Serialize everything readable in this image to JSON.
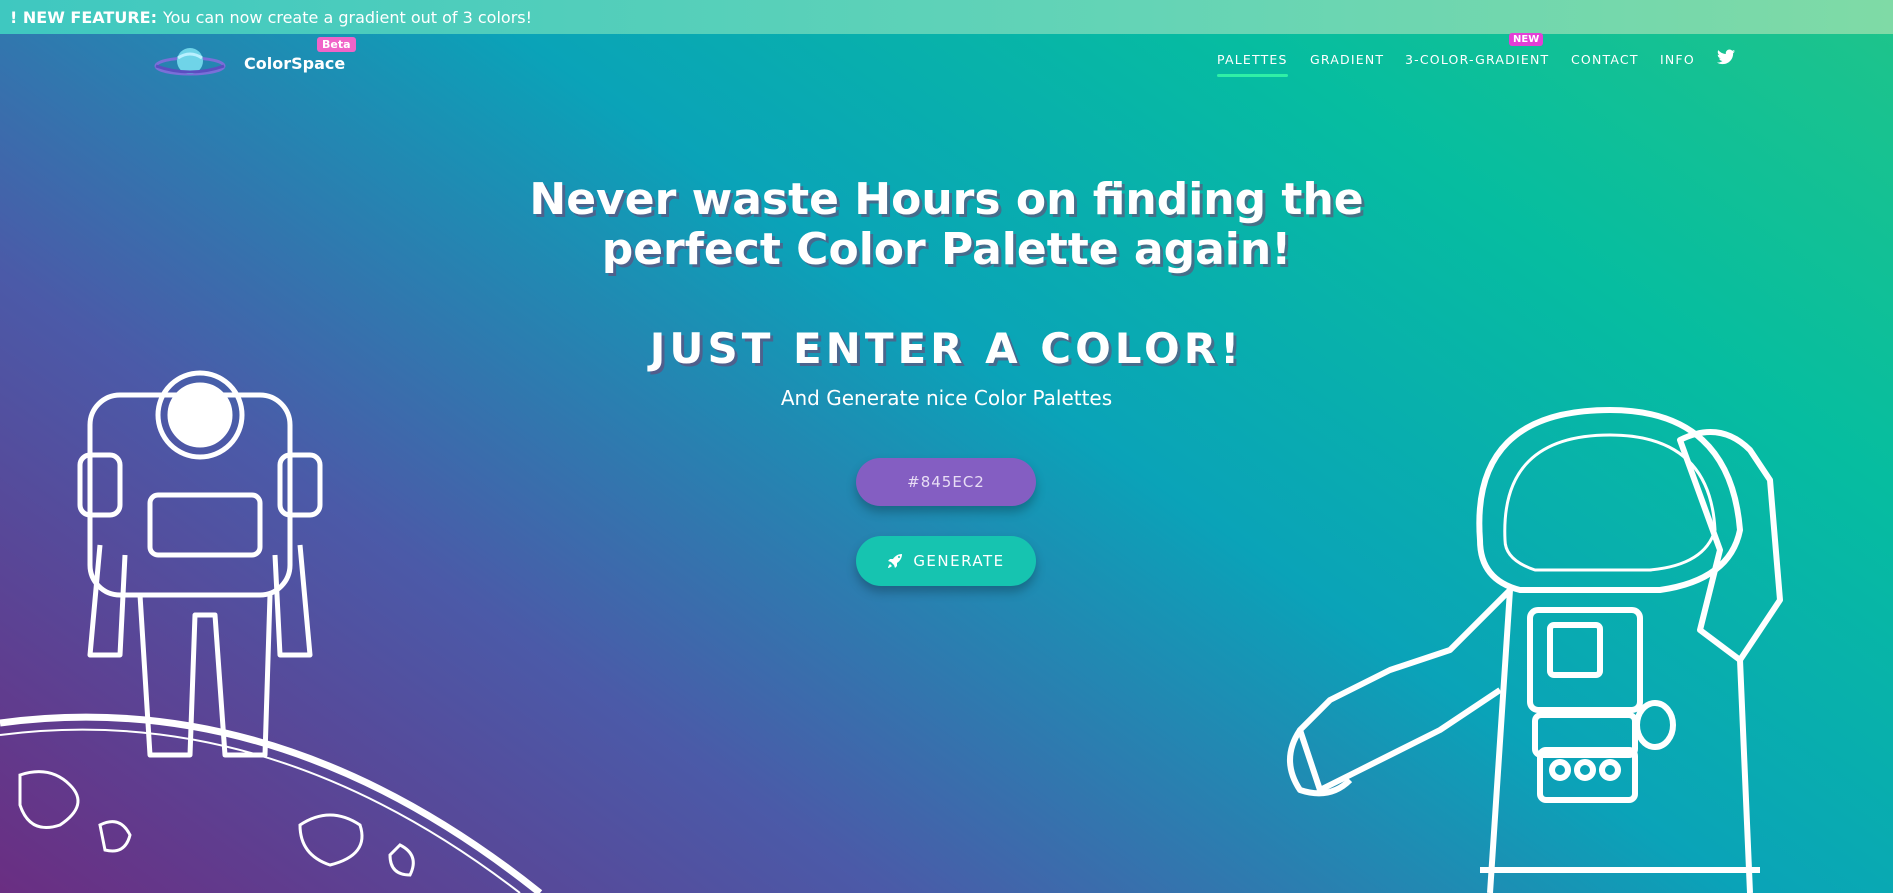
{
  "announcement": {
    "label": "! NEW FEATURE:",
    "text": "You can now create a gradient out of 3 colors!"
  },
  "brand": {
    "name": "ColorSpace",
    "badge": "Beta"
  },
  "nav": {
    "items": [
      {
        "label": "PALETTES",
        "active": true
      },
      {
        "label": "GRADIENT",
        "active": false
      },
      {
        "label": "3-COLOR-GRADIENT",
        "active": false
      },
      {
        "label": "CONTACT",
        "active": false
      },
      {
        "label": "INFO",
        "active": false
      }
    ],
    "new_badge": "NEW",
    "twitter_icon": "twitter-icon"
  },
  "hero": {
    "headline_line1": "Never waste Hours on finding the",
    "headline_line2": "perfect Color Palette again!",
    "cta_heading": "JUST ENTER A COLOR!",
    "subheading": "And Generate nice Color Palettes"
  },
  "form": {
    "color_value": "#845EC2",
    "generate_label": "GENERATE",
    "generate_icon": "rocket-icon"
  },
  "colors": {
    "input_bg": "#845ec2",
    "button_bg": "#16c4b0",
    "active_underline": "#2ff0a6",
    "beta_badge": "#f064c8",
    "new_badge": "#e43fd6"
  }
}
